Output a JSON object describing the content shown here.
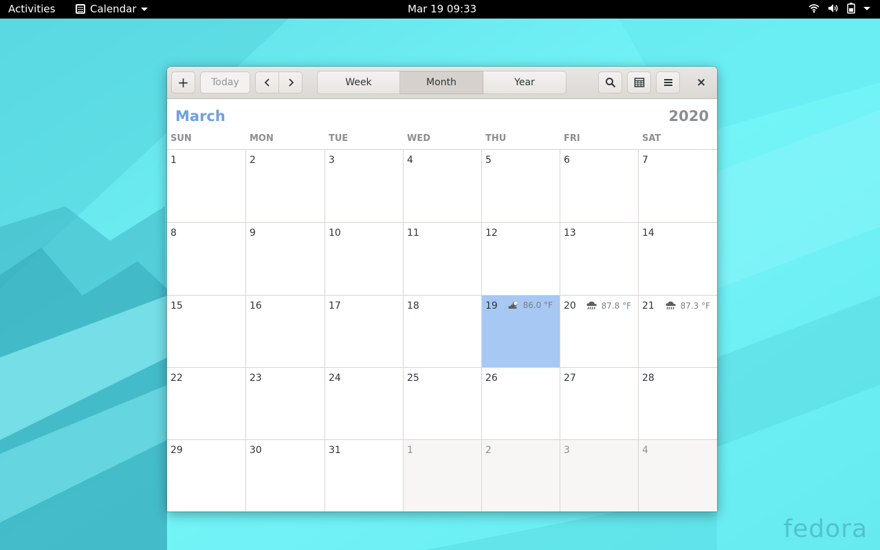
{
  "topbar": {
    "activities": "Activities",
    "app_name": "Calendar",
    "clock": "Mar 19  09:33",
    "icons": [
      "wifi-icon",
      "volume-icon",
      "battery-icon",
      "system-menu-caret-icon"
    ]
  },
  "window": {
    "header": {
      "new_event_label": "+",
      "today_label": "Today",
      "prev_icon": "chevron-left-icon",
      "next_icon": "chevron-right-icon",
      "views": [
        {
          "label": "Week",
          "active": false
        },
        {
          "label": "Month",
          "active": true
        },
        {
          "label": "Year",
          "active": false
        }
      ],
      "search_icon": "search-icon",
      "calendars_icon": "calendar-list-icon",
      "menu_icon": "hamburger-menu-icon",
      "close_label": "×"
    },
    "month": "March",
    "year": "2020",
    "weekdays": [
      "SUN",
      "MON",
      "TUE",
      "WED",
      "THU",
      "FRI",
      "SAT"
    ],
    "weeks": [
      [
        {
          "d": "1"
        },
        {
          "d": "2"
        },
        {
          "d": "3"
        },
        {
          "d": "4"
        },
        {
          "d": "5"
        },
        {
          "d": "6"
        },
        {
          "d": "7"
        }
      ],
      [
        {
          "d": "8"
        },
        {
          "d": "9"
        },
        {
          "d": "10"
        },
        {
          "d": "11"
        },
        {
          "d": "12"
        },
        {
          "d": "13"
        },
        {
          "d": "14"
        }
      ],
      [
        {
          "d": "15"
        },
        {
          "d": "16"
        },
        {
          "d": "17"
        },
        {
          "d": "18"
        },
        {
          "d": "19",
          "today": true,
          "weather": {
            "icon": "partly-cloudy-night-icon",
            "temp": "86.0 °F"
          }
        },
        {
          "d": "20",
          "weather": {
            "icon": "rain-cloud-icon",
            "temp": "87.8 °F"
          }
        },
        {
          "d": "21",
          "weather": {
            "icon": "rain-cloud-icon",
            "temp": "87.3 °F"
          }
        }
      ],
      [
        {
          "d": "22"
        },
        {
          "d": "23"
        },
        {
          "d": "24"
        },
        {
          "d": "25"
        },
        {
          "d": "26"
        },
        {
          "d": "27"
        },
        {
          "d": "28"
        }
      ],
      [
        {
          "d": "29"
        },
        {
          "d": "30"
        },
        {
          "d": "31"
        },
        {
          "d": "1",
          "other": true
        },
        {
          "d": "2",
          "other": true
        },
        {
          "d": "3",
          "other": true
        },
        {
          "d": "4",
          "other": true
        }
      ]
    ]
  },
  "desktop": {
    "logo_text": "fedora"
  },
  "colors": {
    "wallpaper": "#6ff0f5",
    "month_title": "#6fa0e0",
    "today_cell": "#a7c8f3"
  }
}
